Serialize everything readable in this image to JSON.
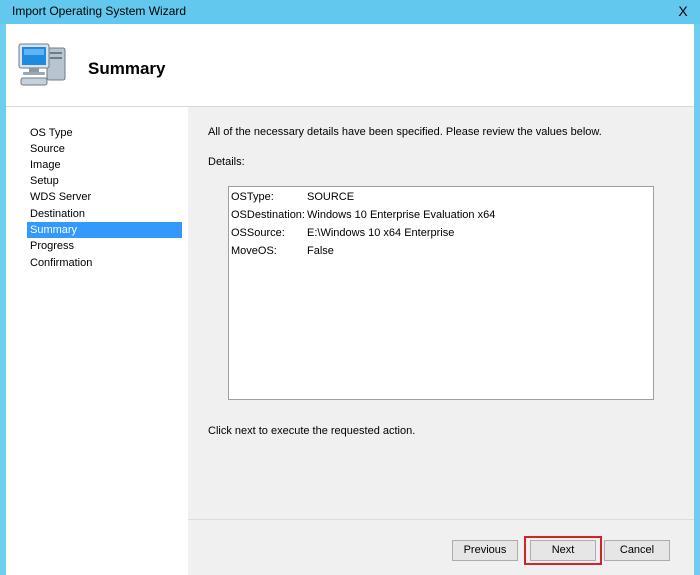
{
  "window": {
    "title": "Import Operating System Wizard",
    "close_label": "X"
  },
  "header": {
    "title": "Summary",
    "icon": "computer-icon"
  },
  "nav": {
    "items": [
      {
        "label": "OS Type",
        "active": false
      },
      {
        "label": "Source",
        "active": false
      },
      {
        "label": "Image",
        "active": false
      },
      {
        "label": "Setup",
        "active": false
      },
      {
        "label": "WDS Server",
        "active": false
      },
      {
        "label": "Destination",
        "active": false
      },
      {
        "label": "Summary",
        "active": true
      },
      {
        "label": "Progress",
        "active": false
      },
      {
        "label": "Confirmation",
        "active": false
      }
    ]
  },
  "content": {
    "intro": "All of the necessary details have been specified.  Please review the values below.",
    "details_label": "Details:",
    "details": [
      {
        "key": "OSType:",
        "value": "SOURCE"
      },
      {
        "key": "OSDestination:",
        "value": "Windows 10 Enterprise Evaluation x64"
      },
      {
        "key": "OSSource:",
        "value": "E:\\Windows 10 x64 Enterprise"
      },
      {
        "key": "MoveOS:",
        "value": "False"
      }
    ],
    "footer": "Click next to execute the requested action."
  },
  "buttons": {
    "previous": "Previous",
    "next": "Next",
    "cancel": "Cancel"
  },
  "colors": {
    "title_bar": "#62c8ee",
    "selection": "#3399ff",
    "next_highlight": "#d2232a"
  }
}
